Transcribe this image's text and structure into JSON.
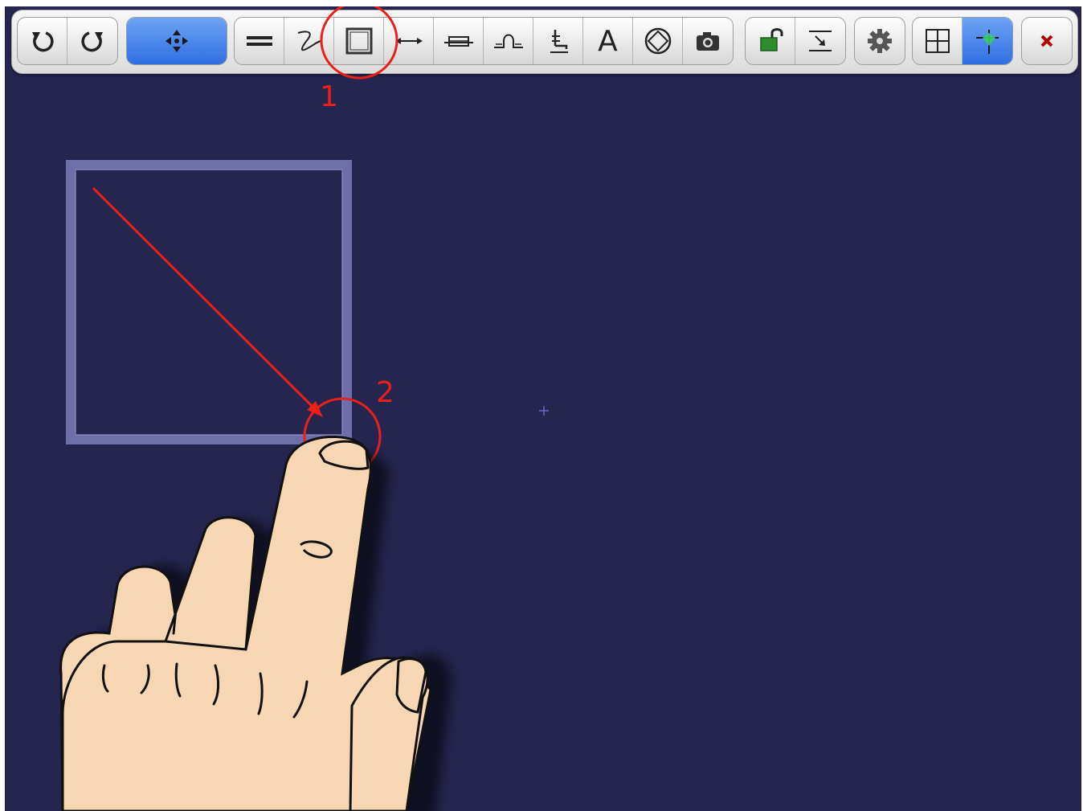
{
  "toolbar": {
    "groups": [
      {
        "name": "history",
        "buttons": [
          "undo-icon",
          "redo-icon"
        ]
      },
      {
        "name": "pan",
        "buttons": [
          "move-arrows-icon"
        ]
      },
      {
        "name": "draw-tools",
        "buttons": [
          "double-line-icon",
          "freehand-icon",
          "rectangle-icon",
          "dimension-arrow-icon",
          "window-icon",
          "step-icon",
          "chair-icon",
          "text-icon",
          "target-icon",
          "camera-icon"
        ]
      },
      {
        "name": "lock-tools",
        "buttons": [
          "unlock-icon",
          "import-icon"
        ]
      },
      {
        "name": "settings",
        "buttons": [
          "gear-icon"
        ]
      },
      {
        "name": "view",
        "buttons": [
          "grid-icon",
          "snap-icon"
        ]
      },
      {
        "name": "close",
        "buttons": [
          "close-icon"
        ]
      }
    ],
    "text_tool_glyph": "A",
    "active_buttons": [
      "move-arrows-icon",
      "snap-icon"
    ],
    "highlighted_button": "rectangle-icon"
  },
  "annotations": {
    "step_1": "1",
    "step_2": "2",
    "color": "#e8201c"
  },
  "colors": {
    "canvas_background": "#25254f",
    "rectangle_stroke": "#6e6ea8",
    "active_button": "#3f7ee6",
    "hand_skin": "#f7d6b4",
    "close_icon": "#b00000",
    "lock_icon": "#2e8b2e"
  }
}
